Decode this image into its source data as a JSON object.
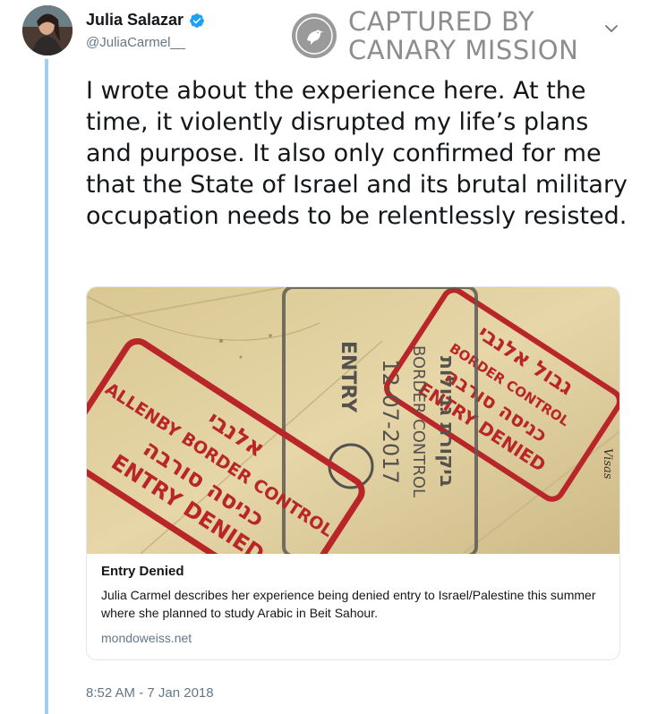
{
  "user": {
    "display_name": "Julia Salazar",
    "handle": "@JuliaCarmel__",
    "verified": true
  },
  "watermark": {
    "line1": "CAPTURED BY",
    "line2": "CANARY MISSION"
  },
  "tweet": {
    "text": "I wrote about the experience here. At the time, it violently disrupted my life’s plans and purpose. It also only confirmed for me that the State of Israel and its brutal military occupation needs to be relentlessly resisted.",
    "timestamp": "8:52 AM - 7 Jan 2018"
  },
  "card": {
    "title": "Entry Denied",
    "description": "Julia Carmel describes her experience being denied entry to Israel/Palestine this summer where she planned to study Arabic in Beit Sahour.",
    "domain": "mondoweiss.net",
    "image": {
      "stamp_left_hebrew_top": "אלנבי",
      "stamp_left_line1": "ALLENBY BORDER CONTROL",
      "stamp_left_line2": "ENTRY DENIED",
      "stamp_middle_line1": "BORDER CONTROL",
      "stamp_middle_date": "12-07-2017",
      "stamp_middle_line2": "ENTRY",
      "stamp_right_line1": "BORDER CONTROL",
      "stamp_right_line2": "ENTRY DENIED",
      "page_label": "Visas"
    }
  },
  "colors": {
    "accent": "#1da1f2",
    "thread_line": "#9ecff0",
    "secondary_text": "#657786",
    "stamp_red": "#b8262a",
    "paper": "#d8c79a"
  }
}
